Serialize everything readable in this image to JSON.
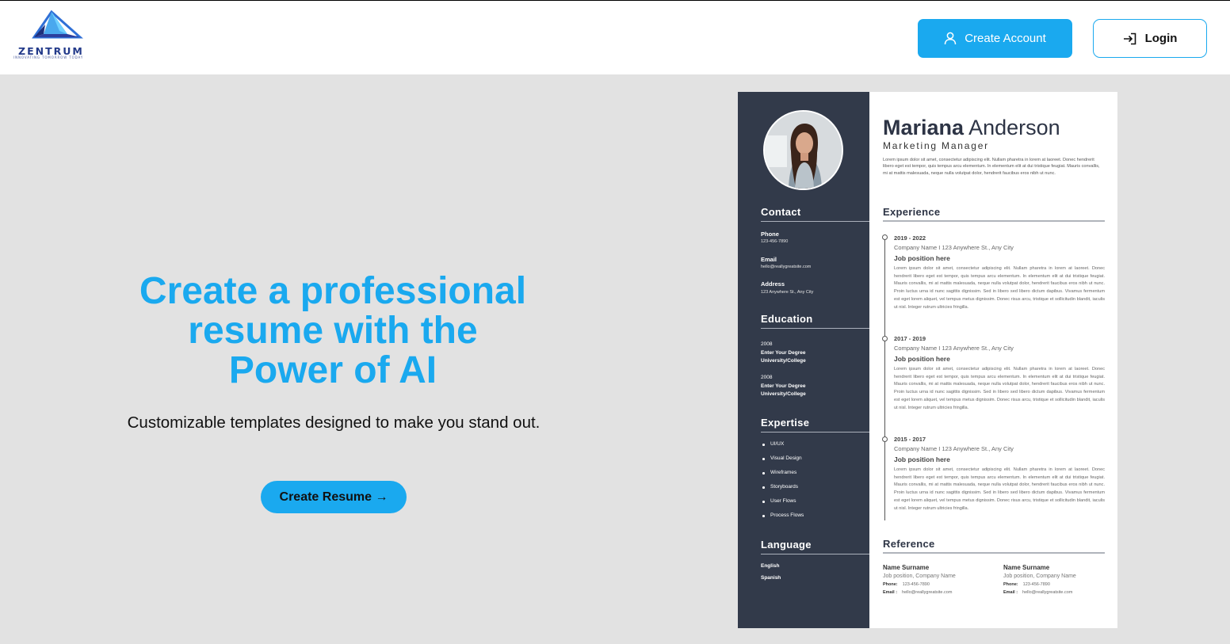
{
  "brand": {
    "name": "ZENTRUM",
    "tagline": "INNOVATING TOMORROW TODAY",
    "color": "#233a8a"
  },
  "header": {
    "create_account": {
      "label": "Create Account",
      "icon": "user-icon"
    },
    "login": {
      "label": "Login",
      "icon": "login-arrow-icon"
    }
  },
  "hero": {
    "title_line1": "Create a professional",
    "title_line2": "resume with the",
    "title_line3": "Power of AI",
    "subtitle": "Customizable templates designed to make you stand out.",
    "cta": "Create Resume →"
  },
  "colors": {
    "accent": "#1aa9ef",
    "background": "#e2e2e2",
    "resume_sidebar": "#323a4a"
  },
  "resume": {
    "first_name": "Mariana",
    "last_name": "Anderson",
    "role": "Marketing Manager",
    "intro": "Lorem ipsum dolor sit amet, consectetur adipiscing elit. Nullam pharetra in lorem at laoreet. Donec hendrerit libero eget est tempor, quis tempus arcu elementum. In elementum elit at dui tristique feugiat. Mauris convallis, mi at mattis malesuada, neque nulla volutpat dolor, hendrerit faucibus eros nibh ut nunc.",
    "contact": {
      "heading": "Contact",
      "phone_label": "Phone",
      "phone": "123-456-7890",
      "email_label": "Email",
      "email": "hello@reallygreatsite.com",
      "address_label": "Address",
      "address": "123 Anywhere St., Any City"
    },
    "education": {
      "heading": "Education",
      "items": [
        {
          "year": "2008",
          "degree": "Enter Your Degree",
          "school": "University/College"
        },
        {
          "year": "2008",
          "degree": "Enter Your Degree",
          "school": "University/College"
        }
      ]
    },
    "expertise": {
      "heading": "Expertise",
      "items": [
        "UI/UX",
        "Visual Design",
        "Wireframes",
        "Storyboards",
        "User Flows",
        "Process Flows"
      ]
    },
    "language": {
      "heading": "Language",
      "items": [
        "English",
        "Spanish"
      ]
    },
    "experience": {
      "heading": "Experience",
      "items": [
        {
          "years": "2019 - 2022",
          "company": "Company Name I 123 Anywhere St., Any City",
          "position": "Job position here",
          "desc": "Lorem ipsum dolor sit amet, consectetur adipiscing elit. Nullam pharetra in lorem at laoreet. Donec hendrerit libero eget est tempor, quis tempus arcu elementum. In elementum elit at dui tristique feugiat. Mauris convallis, mi at mattis malesuada, neque nulla volutpat dolor, hendrerit faucibus eros nibh ut nunc. Proin luctus urna id nunc sagittis dignissim. Sed in libero sed libero dictum dapibus. Vivamus fermentum est eget lorem aliquet, vel tempus metus dignissim. Donec risus arcu, tristique et sollicitudin blandit, iaculis ut nisl. Integer rutrum ultricies fringilla."
        },
        {
          "years": "2017 - 2019",
          "company": "Company Name I 123 Anywhere St., Any City",
          "position": "Job position here",
          "desc": "Lorem ipsum dolor sit amet, consectetur adipiscing elit. Nullam pharetra in lorem at laoreet. Donec hendrerit libero eget est tempor, quis tempus arcu elementum. In elementum elit at dui tristique feugiat. Mauris convallis, mi at mattis malesuada, neque nulla volutpat dolor, hendrerit faucibus eros nibh ut nunc. Proin luctus urna id nunc sagittis dignissim. Sed in libero sed libero dictum dapibus. Vivamus fermentum est eget lorem aliquet, vel tempus metus dignissim. Donec risus arcu, tristique et sollicitudin blandit, iaculis ut nisl. Integer rutrum ultricies fringilla."
        },
        {
          "years": "2015 - 2017",
          "company": "Company Name I 123 Anywhere St., Any City",
          "position": "Job position here",
          "desc": "Lorem ipsum dolor sit amet, consectetur adipiscing elit. Nullam pharetra in lorem at laoreet. Donec hendrerit libero eget est tempor, quis tempus arcu elementum. In elementum elit at dui tristique feugiat. Mauris convallis, mi at mattis malesuada, neque nulla volutpat dolor, hendrerit faucibus eros nibh ut nunc. Proin luctus urna id nunc sagittis dignissim. Sed in libero sed libero dictum dapibus. Vivamus fermentum est eget lorem aliquet, vel tempus metus dignissim. Donec risus arcu, tristique et sollicitudin blandit, iaculis ut nisl. Integer rutrum ultricies fringilla."
        }
      ]
    },
    "reference": {
      "heading": "Reference",
      "items": [
        {
          "name": "Name Surname",
          "position": "Job position, Company Name",
          "phone_label": "Phone:",
          "phone": "123-456-7890",
          "email_label": "Email :",
          "email": "hello@reallygreatsite.com"
        },
        {
          "name": "Name Surname",
          "position": "Job position, Company Name",
          "phone_label": "Phone:",
          "phone": "123-456-7890",
          "email_label": "Email :",
          "email": "hello@reallygreatsite.com"
        }
      ]
    }
  }
}
